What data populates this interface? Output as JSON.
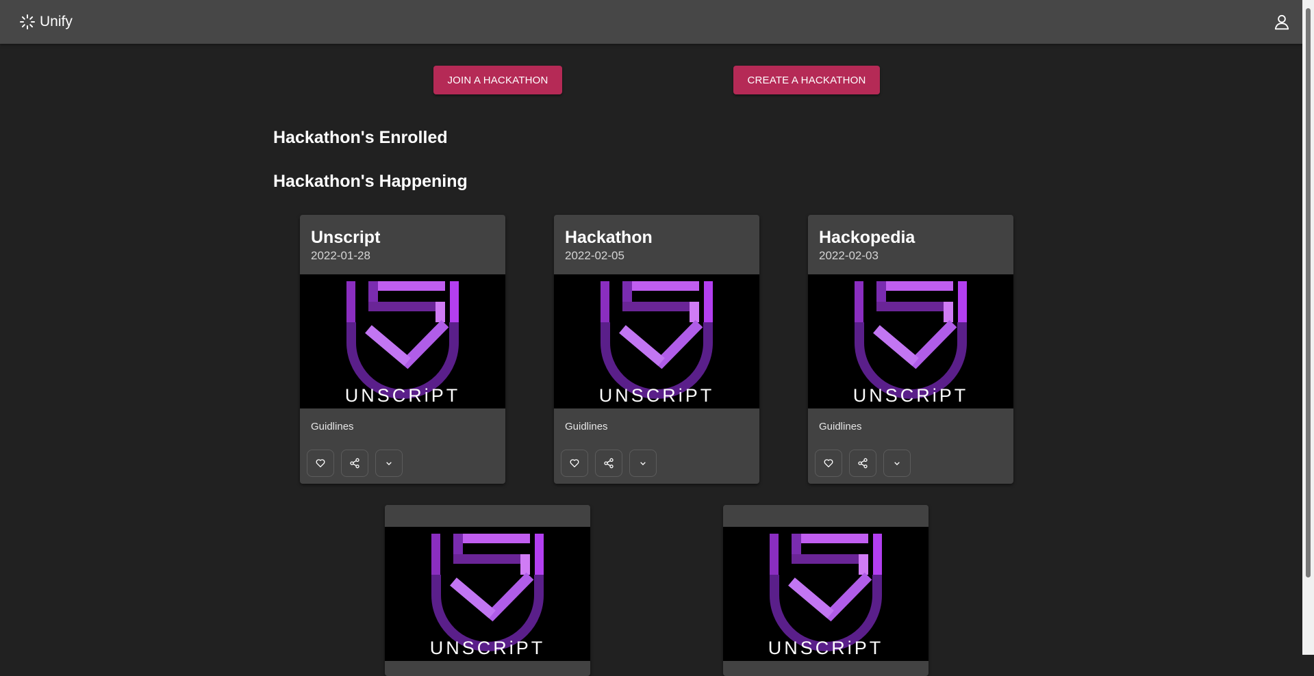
{
  "app": {
    "name": "Unify"
  },
  "icons": {
    "brand": "loading-spinner-icon",
    "account": "person-icon",
    "like": "heart-icon",
    "share": "share-icon",
    "expand": "chevron-down-icon"
  },
  "colors": {
    "appbar": "#474747",
    "background": "#212121",
    "accent": "#b52a56",
    "card": "#424242",
    "logo_purple": "#b44ce0"
  },
  "actions": {
    "join_label": "JOIN A HACKATHON",
    "create_label": "CREATE A HACKATHON"
  },
  "sections": {
    "enrolled_title": "Hackathon's Enrolled",
    "happening_title": "Hackathon's Happening"
  },
  "media_logo_text": "UNSCRiPT",
  "hackathons": [
    {
      "title": "Unscript",
      "date": "2022-01-28",
      "guidelines": "Guidlines"
    },
    {
      "title": "Hackathon",
      "date": "2022-02-05",
      "guidelines": "Guidlines"
    },
    {
      "title": "Hackopedia",
      "date": "2022-02-03",
      "guidelines": "Guidlines"
    },
    {
      "title": "",
      "date": "",
      "guidelines": ""
    },
    {
      "title": "",
      "date": "",
      "guidelines": ""
    }
  ]
}
